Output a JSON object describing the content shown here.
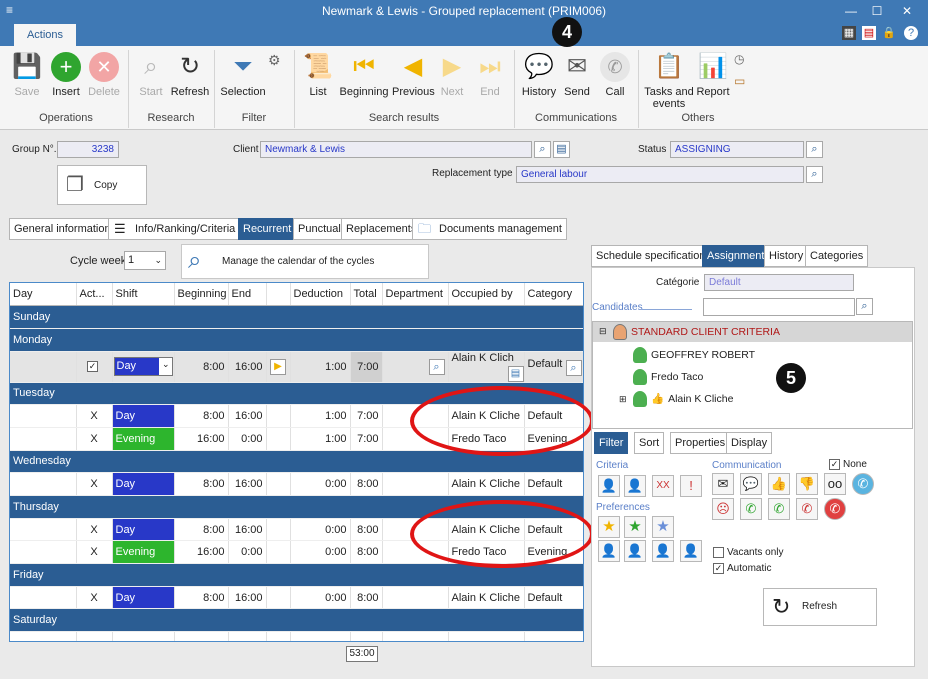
{
  "window": {
    "title": "Newmark & Lewis - Grouped replacement (PRIM006)"
  },
  "ribbon": {
    "tab": "Actions",
    "buttons": {
      "save": "Save",
      "insert": "Insert",
      "delete": "Delete",
      "start": "Start",
      "refresh": "Refresh",
      "selection": "Selection",
      "list": "List",
      "beginning": "Beginning",
      "previous": "Previous",
      "next": "Next",
      "end": "End",
      "history": "History",
      "send": "Send",
      "call": "Call",
      "tasks_line1": "Tasks and",
      "tasks_line2": "events",
      "report": "Report"
    },
    "groups": {
      "operations": "Operations",
      "research": "Research",
      "filter": "Filter",
      "search_results": "Search results",
      "communications": "Communications",
      "others": "Others"
    }
  },
  "header": {
    "group_no_label": "Group N°.",
    "group_no": "3238",
    "client_label": "Client",
    "client": "Newmark & Lewis",
    "status_label": "Status",
    "status": "ASSIGNING",
    "copy_label": "Copy",
    "replacement_type_label": "Replacement type",
    "replacement_type": "General labour"
  },
  "tabs": {
    "general": "General informations",
    "info": "Info/Ranking/Criteria",
    "recurrent": "Recurrent",
    "punctual": "Punctual",
    "replacements": "Replacements",
    "documents": "Documents management"
  },
  "cycle": {
    "label": "Cycle week",
    "value": "1",
    "manage": "Manage the calendar of the cycles"
  },
  "grid": {
    "columns": [
      "Day",
      "Act...",
      "Shift",
      "Beginning",
      "End",
      "",
      "Deduction",
      "Total",
      "Department",
      "Occupied by",
      "Category"
    ],
    "days": {
      "sunday": "Sunday",
      "monday": "Monday",
      "tuesday": "Tuesday",
      "wednesday": "Wednesday",
      "thursday": "Thursday",
      "friday": "Friday",
      "saturday": "Saturday"
    },
    "monday_row": {
      "shift": "Day",
      "beginning": "8:00",
      "end": "16:00",
      "deduction": "1:00",
      "total": "7:00",
      "occupied": "Alain K Clich",
      "category": "Default"
    },
    "tuesday_rows": [
      {
        "act": "X",
        "shift": "Day",
        "beginning": "8:00",
        "end": "16:00",
        "deduction": "1:00",
        "total": "7:00",
        "occupied": "Alain K Cliche",
        "category": "Default"
      },
      {
        "act": "X",
        "shift": "Evening",
        "beginning": "16:00",
        "end": "0:00",
        "deduction": "1:00",
        "total": "7:00",
        "occupied": "Fredo Taco",
        "category": "Evening"
      }
    ],
    "wednesday_rows": [
      {
        "act": "X",
        "shift": "Day",
        "beginning": "8:00",
        "end": "16:00",
        "deduction": "0:00",
        "total": "8:00",
        "occupied": "Alain K Cliche",
        "category": "Default"
      }
    ],
    "thursday_rows": [
      {
        "act": "X",
        "shift": "Day",
        "beginning": "8:00",
        "end": "16:00",
        "deduction": "0:00",
        "total": "8:00",
        "occupied": "Alain K Cliche",
        "category": "Default"
      },
      {
        "act": "X",
        "shift": "Evening",
        "beginning": "16:00",
        "end": "0:00",
        "deduction": "0:00",
        "total": "8:00",
        "occupied": "Fredo Taco",
        "category": "Evening"
      }
    ],
    "friday_rows": [
      {
        "act": "X",
        "shift": "Day",
        "beginning": "8:00",
        "end": "16:00",
        "deduction": "0:00",
        "total": "8:00",
        "occupied": "Alain K Cliche",
        "category": "Default"
      }
    ],
    "grand_total": "53:00"
  },
  "right": {
    "tabs": {
      "schedule": "Schedule specifications",
      "assignment": "Assignment",
      "history": "History",
      "categories": "Categories"
    },
    "categorie_label": "Catégorie",
    "categorie": "Default",
    "candidates_label": "Candidates",
    "tree": {
      "root": "STANDARD CLIENT CRITERIA",
      "c1": "GEOFFREY ROBERT",
      "c2": "Fredo Taco",
      "c3": "Alain K Cliche"
    },
    "subtabs": {
      "filter": "Filter",
      "sort": "Sort",
      "properties": "Properties",
      "display": "Display"
    },
    "criteria_label": "Criteria",
    "communication_label": "Communication",
    "none_label": "None",
    "preferences_label": "Preferences",
    "vacants_label": "Vacants only",
    "automatic_label": "Automatic",
    "refresh": "Refresh"
  },
  "callouts": {
    "four": "4",
    "five": "5"
  },
  "colors": {
    "accent": "#2b5d93",
    "title": "#3f79b5",
    "shift_day": "#2838c8",
    "shift_evening": "#2db52d",
    "annotation": "#e01515"
  }
}
